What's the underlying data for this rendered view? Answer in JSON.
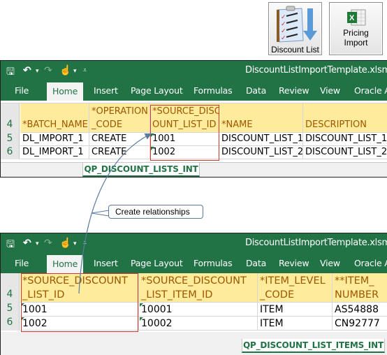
{
  "ribbon_buttons": [
    {
      "label": "Discount List",
      "icon": "discount-list-icon"
    },
    {
      "label_line1": "Pricing",
      "label_line2": "Import",
      "icon": "excel-icon"
    }
  ],
  "window1": {
    "title": "DiscountListImportTemplate.xlsm -",
    "tabs": [
      "File",
      "Home",
      "Insert",
      "Page Layout",
      "Formulas",
      "Data",
      "Review",
      "View",
      "Oracle A"
    ],
    "active_tab": "Home",
    "row_numbers": [
      "4",
      "5",
      "6"
    ],
    "header_cells": [
      {
        "line1": "",
        "line2": "*BATCH_NAME"
      },
      {
        "line1": "*OPERATION",
        "line2": "_CODE"
      },
      {
        "line1": "*SOURCE_DISC",
        "line2": "OUNT_LIST_ID"
      },
      {
        "line1": "",
        "line2": "*NAME"
      },
      {
        "line1": "",
        "line2": "DESCRIPTION"
      }
    ],
    "rows": [
      [
        "DL_IMPORT_1",
        "CREATE",
        "1001",
        "DISCOUNT_LIST_1",
        "DISCOUNT_LIST_1"
      ],
      [
        "DL_IMPORT_1",
        "CREATE",
        "1002",
        "DISCOUNT_LIST_2",
        "DISCOUNT_LIST_2"
      ]
    ],
    "sheet_tab": "QP_DISCOUNT_LISTS_INT"
  },
  "callout": {
    "text": "Create relationships"
  },
  "window2": {
    "title": "DiscountListImportTemplate.xlsm -",
    "tabs": [
      "File",
      "Home",
      "Insert",
      "Page Layout",
      "Formulas",
      "Data",
      "Review",
      "View",
      "Oracle A"
    ],
    "active_tab": "Home",
    "row_numbers": [
      "4",
      "5",
      "6"
    ],
    "header_cells": [
      {
        "line1": "*SOURCE_DISCOUNT",
        "line2": "_LIST_ID"
      },
      {
        "line1": "*SOURCE_DISCOUNT",
        "line2": "_LIST_ITEM_ID"
      },
      {
        "line1": "*ITEM_LEVEL",
        "line2": "_CODE"
      },
      {
        "line1": "**ITEM_",
        "line2": "NUMBER"
      }
    ],
    "rows": [
      [
        "1001",
        "10001",
        "ITEM",
        "AS54888"
      ],
      [
        "1002",
        "10002",
        "ITEM",
        "CN92777"
      ]
    ],
    "sheet_tab": "QP_DISCOUNT_LIST_ITEMS_INT"
  },
  "colors": {
    "excel_green": "#217346",
    "header_fill": "#ffeb9c",
    "header_text": "#9c5700",
    "highlight_border": "#d33a2f",
    "connector": "#5a7aa0"
  }
}
